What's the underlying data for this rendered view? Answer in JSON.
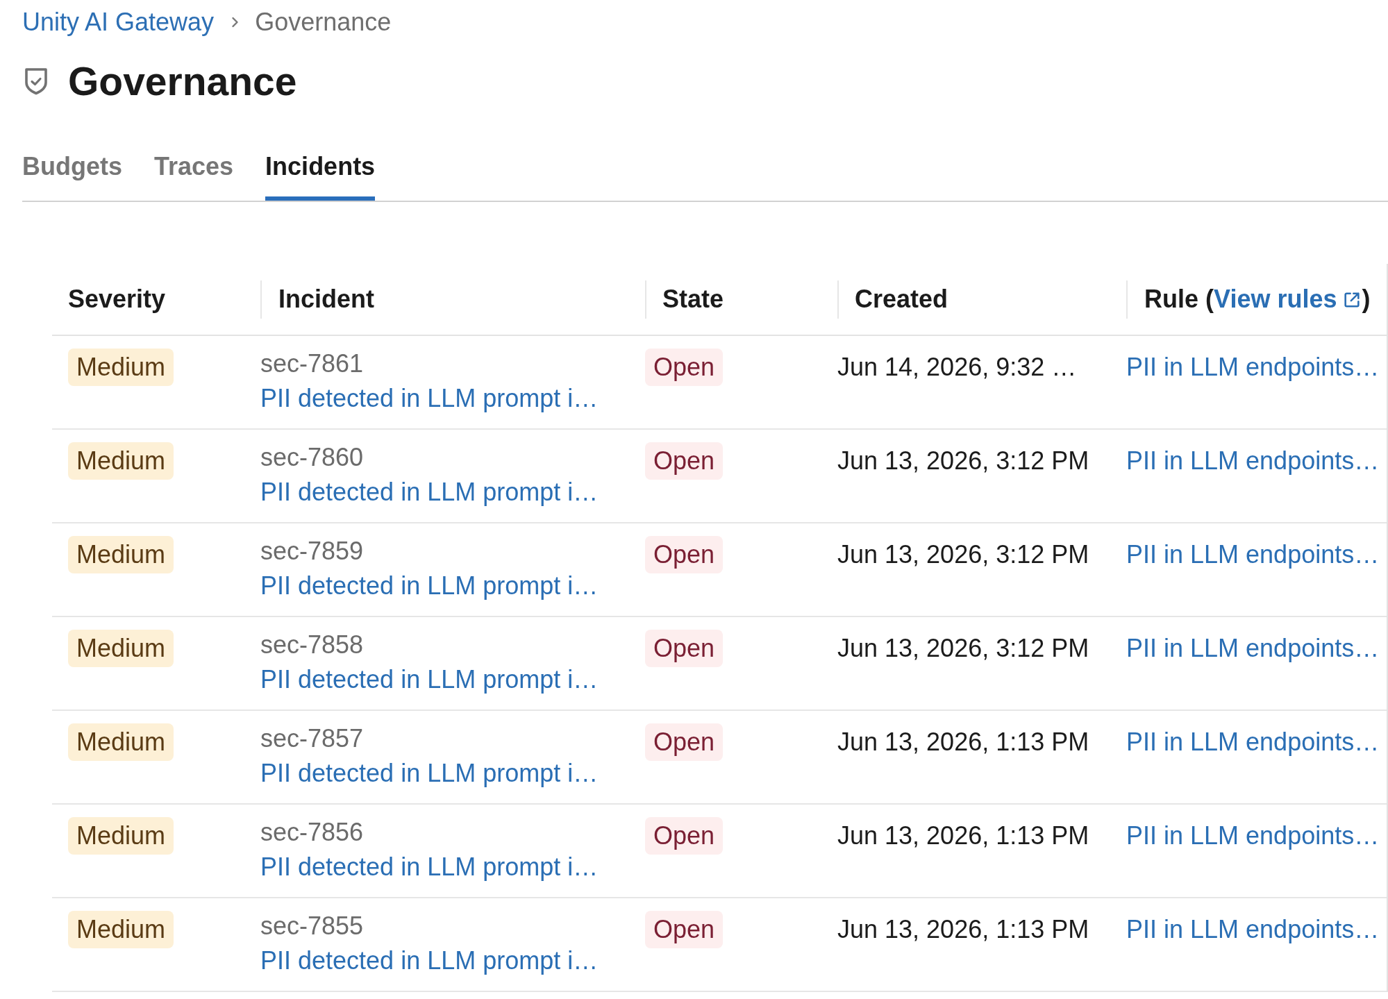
{
  "breadcrumb": [
    {
      "label": "Unity AI Gateway",
      "kind": "link"
    },
    {
      "label": "Governance",
      "kind": "current"
    }
  ],
  "page": {
    "title": "Governance"
  },
  "tabs": [
    {
      "label": "Budgets",
      "selected": false
    },
    {
      "label": "Traces",
      "selected": false
    },
    {
      "label": "Incidents",
      "selected": true
    }
  ],
  "table": {
    "columns": [
      {
        "label": "Severity"
      },
      {
        "label": "Incident"
      },
      {
        "label": "State"
      },
      {
        "label": "Created"
      },
      {
        "label": "Rule (",
        "link": "View rules",
        "suffix": ")"
      }
    ],
    "rows": [
      {
        "severity": "Medium",
        "id": "sec-7861",
        "title": "PII detected in LLM prompt i…",
        "state": "Open",
        "created": "Jun 14, 2026, 9:32 …",
        "rule": "PII in LLM endpoints…"
      },
      {
        "severity": "Medium",
        "id": "sec-7860",
        "title": "PII detected in LLM prompt i…",
        "state": "Open",
        "created": "Jun 13, 2026, 3:12 PM",
        "rule": "PII in LLM endpoints…"
      },
      {
        "severity": "Medium",
        "id": "sec-7859",
        "title": "PII detected in LLM prompt i…",
        "state": "Open",
        "created": "Jun 13, 2026, 3:12 PM",
        "rule": "PII in LLM endpoints…"
      },
      {
        "severity": "Medium",
        "id": "sec-7858",
        "title": "PII detected in LLM prompt i…",
        "state": "Open",
        "created": "Jun 13, 2026, 3:12 PM",
        "rule": "PII in LLM endpoints…"
      },
      {
        "severity": "Medium",
        "id": "sec-7857",
        "title": "PII detected in LLM prompt i…",
        "state": "Open",
        "created": "Jun 13, 2026, 1:13 PM",
        "rule": "PII in LLM endpoints…"
      },
      {
        "severity": "Medium",
        "id": "sec-7856",
        "title": "PII detected in LLM prompt i…",
        "state": "Open",
        "created": "Jun 13, 2026, 1:13 PM",
        "rule": "PII in LLM endpoints…"
      },
      {
        "severity": "Medium",
        "id": "sec-7855",
        "title": "PII detected in LLM prompt i…",
        "state": "Open",
        "created": "Jun 13, 2026, 1:13 PM",
        "rule": "PII in LLM endpoints…"
      }
    ]
  }
}
